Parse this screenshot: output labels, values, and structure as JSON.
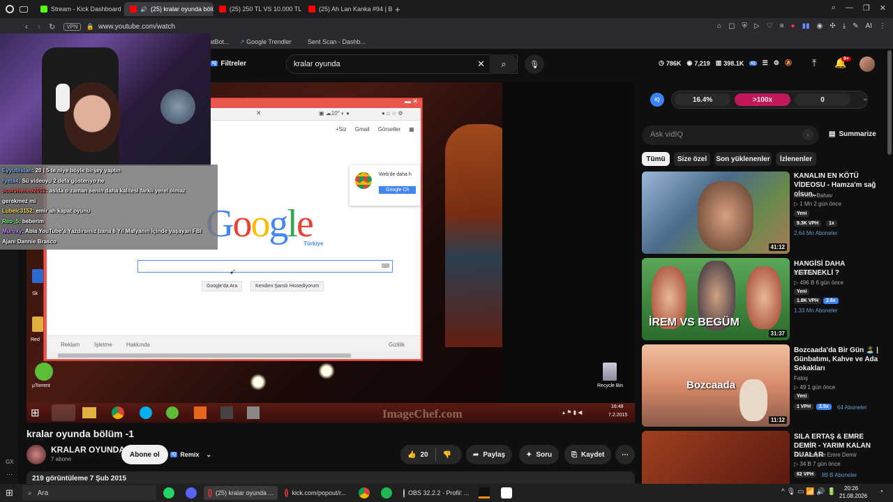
{
  "browser": {
    "tabs": [
      {
        "label": "Stream - Kick Dashboard",
        "color": "#53fc18"
      },
      {
        "label": "(25) kralar oyunda bölü",
        "color": "#ff0000"
      },
      {
        "label": "(25) 250 TL VS 10.000 TL",
        "color": "#ff0000"
      },
      {
        "label": "(25) Ah Lan Kanka #94 | B",
        "color": "#ff0000"
      }
    ],
    "vpn_label": "VPN",
    "url": "www.youtube.com/watch",
    "bookmarks": [
      "atBot...",
      "Google Trendler",
      "Sent Scan - Dashb..."
    ],
    "ext_label": "AI"
  },
  "youtube": {
    "filter_label": "Filtreler",
    "search_value": "kralar oyunda",
    "stats": {
      "subs": "786K",
      "views": "7,219",
      "total": "398.1K"
    },
    "notif_count": "9+",
    "vidiq": {
      "badge": "IQ",
      "score1": "16.4%",
      "score2": ">100x",
      "score3": "0",
      "ask_placeholder": "Ask vidIQ",
      "summarize": "Summarize"
    },
    "chips": [
      "Tümü",
      "Size özel",
      "Son yüklenenler",
      "İzlenenler"
    ],
    "recommendations": [
      {
        "title": "KANALIN EN KÖTÜ VİDEOSU - Hamza'm sağ olsun..",
        "channel": "Mevtcan Bahav",
        "meta": "1 Mn  2 gün önce",
        "new": "Yeni",
        "vph": "9.3K VPH",
        "mult": "1x",
        "subs": "2.64 Mn Aboneler",
        "duration": "41:12",
        "thumb_color": "#6e8db0"
      },
      {
        "title": "HANGİSİ DAHA YETENEKLİ ?",
        "channel": "Emiriviv",
        "meta": "496 B  6 gün önce",
        "new": "Yeni",
        "vph": "1.8K VPH",
        "mult": "2.6x",
        "subs": "1.33 Mn Aboneler",
        "duration": "31:37",
        "thumb_color": "#3f8a3a",
        "thumb_text": "İREM VS BEGÜM"
      },
      {
        "title": "Bozcaada'da Bir Gün 🏝️ | Günbatımı, Kahve ve Ada Sokakları",
        "channel": "Fatoş",
        "meta": "49  1 gün önce",
        "new": "Yeni",
        "vph": "1 VPH",
        "mult": "2.5x",
        "subs": "64 Aboneler",
        "duration": "11:12",
        "thumb_color": "#c98d6b",
        "thumb_text": "Bozcaada"
      },
      {
        "title": "SILA ERTAŞ & EMRE DEMİR - YARIM KALAN DUALAR",
        "channel": "Sıla Ertaş ve Emre Demir",
        "meta": "34 B  7 gün önce",
        "new": "",
        "vph": "62 VPH",
        "mult": "",
        "subs": "89 B Aboneler",
        "duration": "",
        "thumb_color": "#7a2a1a"
      }
    ],
    "video": {
      "title": "kralar oyunda bölüm -1",
      "channel": "KRALAR OYUNDA",
      "subs": "7 abone",
      "subscribe": "Abone ol",
      "remix": "Remix",
      "likes": "20",
      "share": "Paylaş",
      "ask": "Soru",
      "save": "Kaydet",
      "views_date": "219 görüntüleme  7 Şub 2015",
      "watermark": "ImageChef.com"
    },
    "in_video": {
      "google_links": [
        "+Siz",
        "Gmail",
        "Görseller"
      ],
      "google_logo": "Google",
      "google_sub": "Türkiye",
      "btn_search": "Google'da Ara",
      "btn_lucky": "Kendimi Şanslı Hissediyorum",
      "footer_links": [
        "Reklam",
        "İşletme",
        "Hakkında"
      ],
      "privacy": "Gizlilik",
      "chrome_promo": "Web'de daha h",
      "chrome_btn": "Google Ch",
      "desktop_icons": [
        "µTorrent",
        "Recycle Bin",
        "Red",
        "Sk"
      ],
      "clock_time": "16:48",
      "clock_date": "7.2.2015"
    }
  },
  "chat": [
    {
      "user": "Eyyubistan",
      "msg": ": 20 | 5 te niye böyle birşey yaptın",
      "color": "#7fb3ff"
    },
    {
      "user": "ryeta4",
      "msg": ": Sü videoyu 2 defa gösteriyo he",
      "color": "#7fb3ff"
    },
    {
      "user": "scorvheneo2012",
      "msg": ": aslda o zaman senin daha kalitesi farklı yerel olmaz",
      "color": "#ff5555"
    },
    {
      "user": "",
      "msg": "gerekmez mi",
      "color": "#ffffff"
    },
    {
      "user": "Lubelc3152",
      "msg": ": emir ah kapat oyunu",
      "color": "#ffe45c"
    },
    {
      "user": "Reo_5",
      "msg": ": beberim",
      "color": "#7dff7d"
    },
    {
      "user": "Muroxy",
      "msg": ": Abla YouTube'a Yazdırsınız bana 6 Yıl Mafyanın İçinde yaşayan FBI",
      "color": "#c58cff"
    },
    {
      "user": "",
      "msg": "Ajanı Dannie Brasco",
      "color": "#ffffff"
    }
  ],
  "taskbar": {
    "search_label": "Ara",
    "apps": [
      "(25) kralar oyunda ...",
      "kick.com/popout/r...",
      "OBS 32.2.2 - Profil: ..."
    ],
    "time": "20:26",
    "date": "21.08.2026"
  },
  "sidebar": {
    "gx_label": "GX"
  },
  "colors": {
    "accent_red": "#ff0033",
    "vidiq_pink": "#c2185b",
    "vidiq_blue": "#3b82f6"
  }
}
